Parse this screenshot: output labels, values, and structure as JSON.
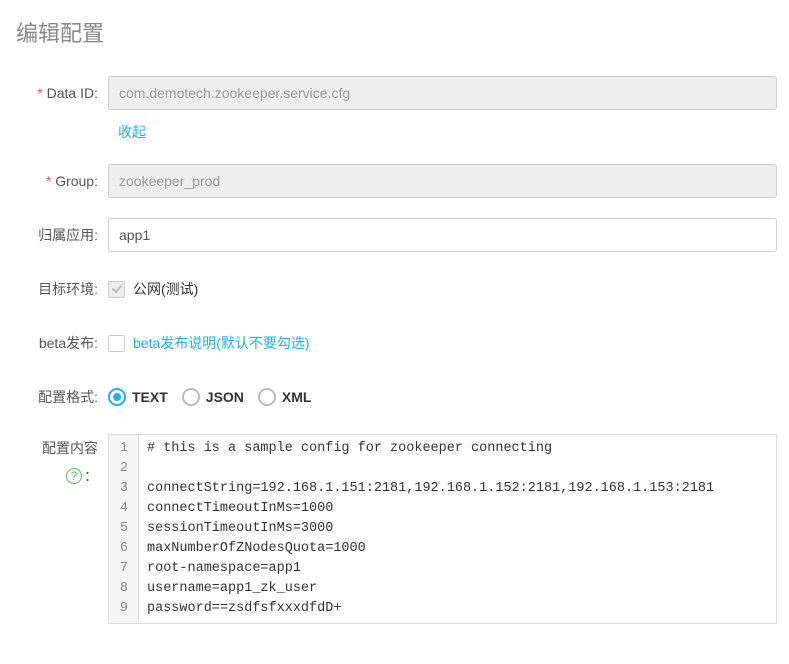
{
  "page_title": "编辑配置",
  "fields": {
    "data_id": {
      "label": "Data ID:",
      "required": true,
      "value": "com.demotech.zookeeper.service.cfg",
      "disabled": true
    },
    "collapse_link": "收起",
    "group": {
      "label": "Group:",
      "required": true,
      "value": "zookeeper_prod",
      "disabled": true
    },
    "app": {
      "label": "归属应用:",
      "value": "app1"
    },
    "target_env": {
      "label": "目标环境:",
      "checked": true,
      "disabled": true,
      "text": "公网(测试)"
    },
    "beta": {
      "label": "beta发布:",
      "checked": false,
      "link_text": "beta发布说明(默认不要勾选)"
    },
    "format": {
      "label": "配置格式:",
      "selected": "TEXT",
      "options": [
        "TEXT",
        "JSON",
        "XML"
      ]
    },
    "content": {
      "label": "配置内容",
      "help_colon": "：",
      "lines": [
        "# this is a sample config for zookeeper connecting",
        "",
        "connectString=192.168.1.151:2181,192.168.1.152:2181,192.168.1.153:2181",
        "connectTimeoutInMs=1000",
        "sessionTimeoutInMs=3000",
        "maxNumberOfZNodesQuota=1000",
        "root-namespace=app1",
        "username=app1_zk_user",
        "password==zsdfsfxxxdfdD+"
      ]
    }
  }
}
